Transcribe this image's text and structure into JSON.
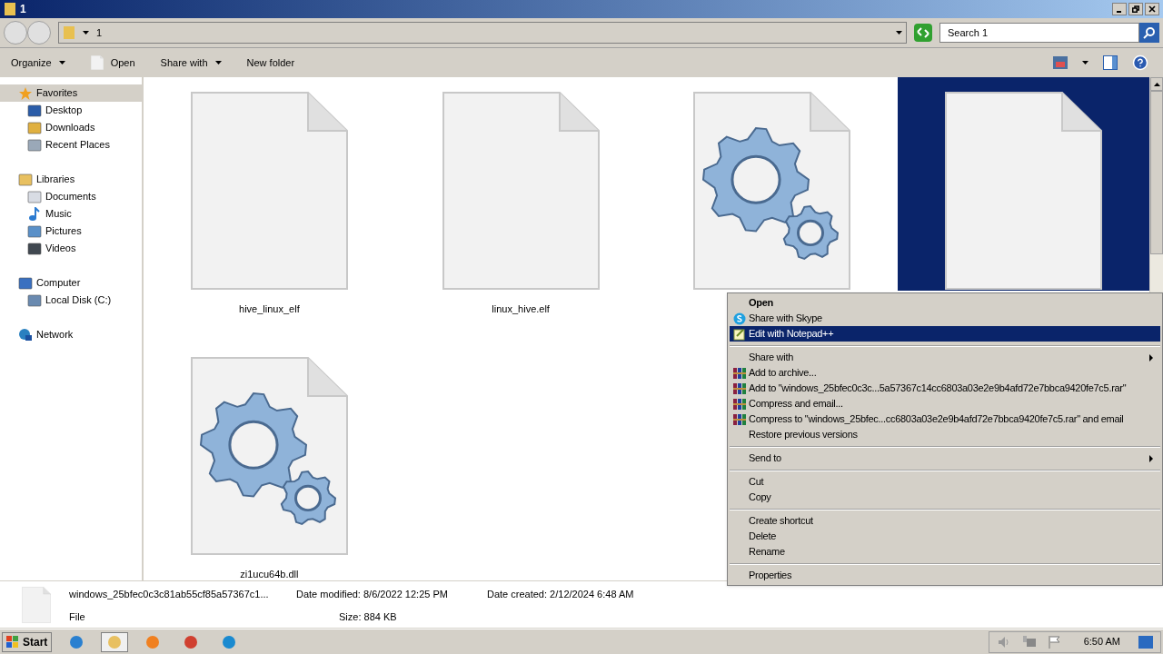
{
  "window": {
    "title": "1"
  },
  "address_bar": {
    "path": "1",
    "search_placeholder": "Search 1"
  },
  "toolbar": [
    {
      "label": "Organize",
      "dropdown": true,
      "kind": "menu"
    },
    {
      "label": "Open",
      "dropdown": false,
      "kind": "open"
    },
    {
      "label": "Share with",
      "dropdown": true,
      "kind": "menu"
    },
    {
      "label": "New folder",
      "dropdown": false,
      "kind": "plain"
    }
  ],
  "sidebar": [
    {
      "label": "Favorites",
      "selected": true,
      "children": [
        {
          "label": "Desktop",
          "selected": false
        },
        {
          "label": "Downloads",
          "selected": false
        },
        {
          "label": "Recent Places",
          "selected": false
        }
      ]
    },
    {
      "label": "Libraries",
      "selected": false,
      "children": [
        {
          "label": "Documents",
          "selected": false
        },
        {
          "label": "Music",
          "selected": false
        },
        {
          "label": "Pictures",
          "selected": false
        },
        {
          "label": "Videos",
          "selected": false
        }
      ]
    },
    {
      "label": "Computer",
      "selected": false,
      "children": [
        {
          "label": "Local Disk (C:)",
          "selected": false
        }
      ]
    },
    {
      "label": "Network",
      "selected": false
    }
  ],
  "files": [
    {
      "name": "hive_linux_elf",
      "kind": "blank",
      "selected": false
    },
    {
      "name": "linux_hive.elf",
      "kind": "blank",
      "selected": false
    },
    {
      "kind": "gears",
      "selected": false
    },
    {
      "kind": "blank",
      "selected": true
    },
    {
      "name": "zi1ucu64b.dll",
      "kind": "gears",
      "selected": false
    }
  ],
  "context_menu": [
    {
      "kind": "plain",
      "label": "Open",
      "bold": true,
      "selected": false
    },
    {
      "kind": "skype",
      "label": "Share with Skype",
      "selected": false
    },
    {
      "kind": "notepad",
      "label": "Edit with Notepad++",
      "selected": true
    },
    {
      "kind": "separator"
    },
    {
      "kind": "plain",
      "label": "Share with",
      "submenu": true,
      "selected": false
    },
    {
      "kind": "archive",
      "label": "Add to archive...",
      "selected": false
    },
    {
      "kind": "archive",
      "label": "Add to \"windows_25bfec0c3c...5a57367c14cc6803a03e2e9b4afd72e7bbca9420fe7c5.rar\"",
      "selected": false
    },
    {
      "kind": "archive",
      "label": "Compress and email...",
      "selected": false
    },
    {
      "kind": "archive",
      "label": "Compress to \"windows_25bfec...cc6803a03e2e9b4afd72e7bbca9420fe7c5.rar\" and email",
      "selected": false
    },
    {
      "kind": "plain",
      "label": "Restore previous versions",
      "selected": false
    },
    {
      "kind": "separator"
    },
    {
      "kind": "plain",
      "label": "Send to",
      "submenu": true,
      "selected": false
    },
    {
      "kind": "separator"
    },
    {
      "kind": "plain",
      "label": "Cut",
      "selected": false
    },
    {
      "kind": "plain",
      "label": "Copy",
      "selected": false
    },
    {
      "kind": "separator"
    },
    {
      "kind": "plain",
      "label": "Create shortcut",
      "selected": false
    },
    {
      "kind": "plain",
      "label": "Delete",
      "selected": false
    },
    {
      "kind": "plain",
      "label": "Rename",
      "selected": false
    },
    {
      "kind": "separator"
    },
    {
      "kind": "plain",
      "label": "Properties",
      "selected": false
    }
  ],
  "details_pane": {
    "name": "windows_25bfec0c3c81ab55cf85a57367c1...",
    "type": "File",
    "fields": [
      {
        "label": "Date modified:",
        "value": "8/6/2022 12:25 PM"
      },
      {
        "label": "Date created:",
        "value": "2/12/2024 6:48 AM"
      },
      {
        "label": "Size:",
        "value": "884 KB"
      }
    ]
  },
  "taskbar": {
    "start": "Start",
    "apps": [
      {
        "selected": false
      },
      {
        "selected": true
      },
      {
        "selected": false
      },
      {
        "selected": false
      },
      {
        "selected": false
      }
    ],
    "clock": "6:50 AM"
  }
}
